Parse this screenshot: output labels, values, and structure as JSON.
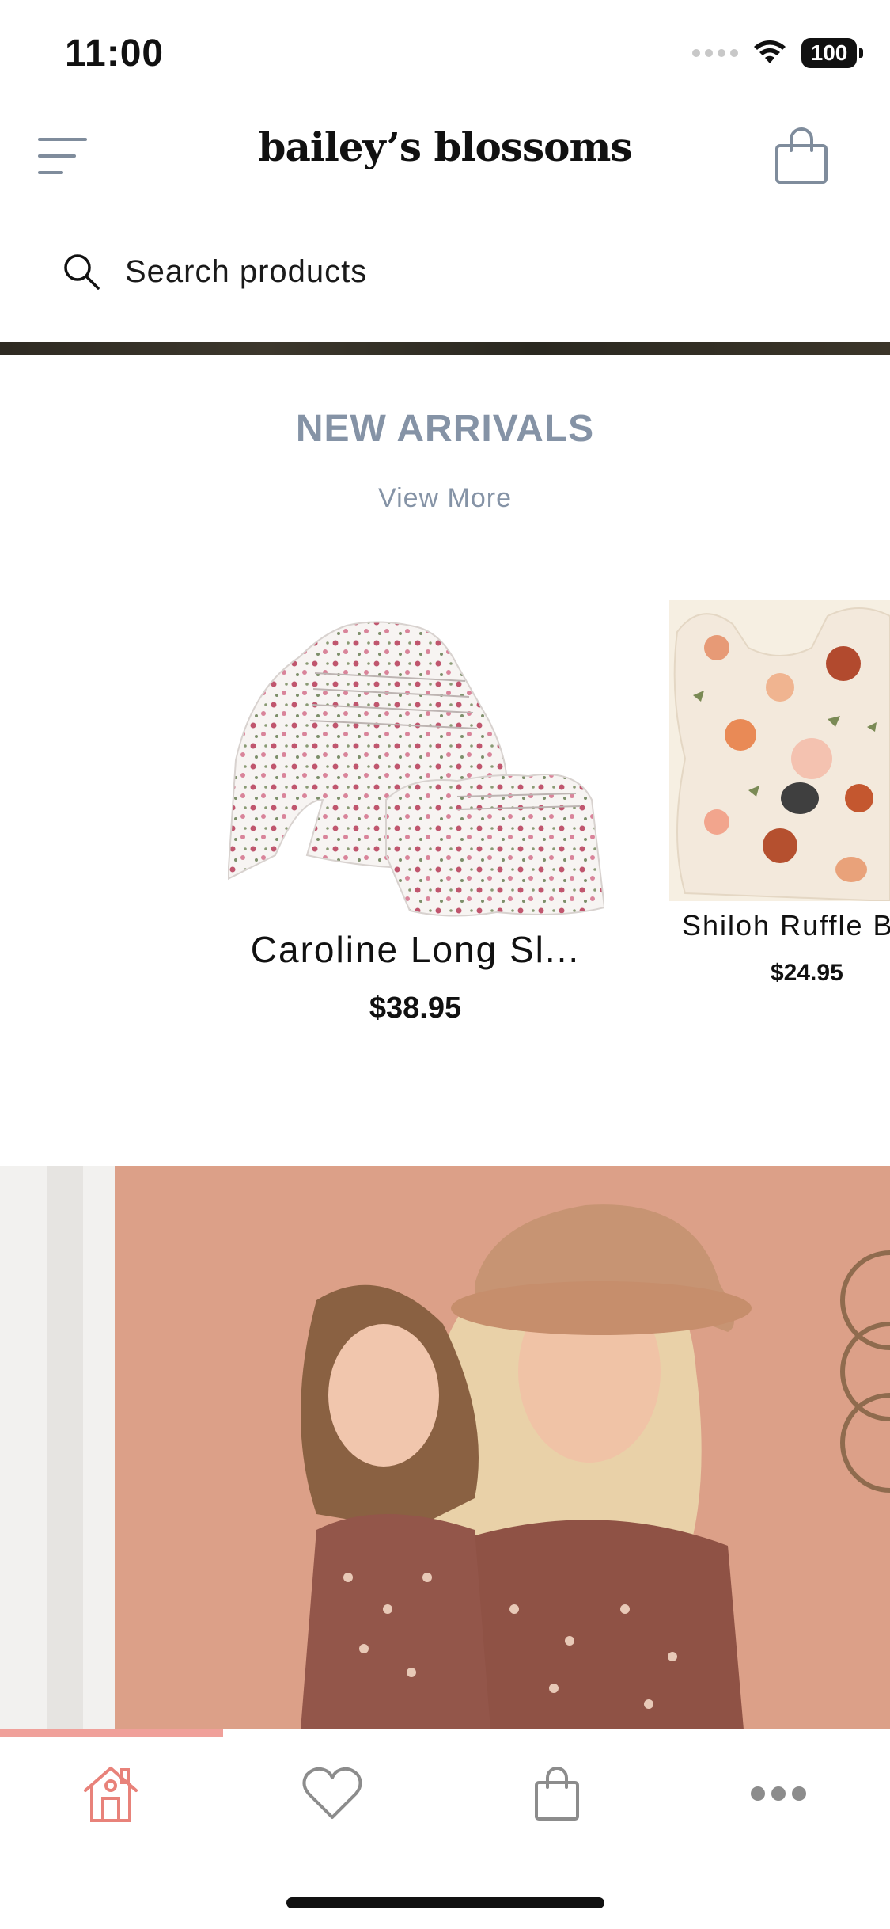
{
  "status_bar": {
    "time": "11:00",
    "battery": "100"
  },
  "header": {
    "brand": "bailey’s blossoms"
  },
  "search": {
    "placeholder": "Search products"
  },
  "section": {
    "title": "NEW ARRIVALS",
    "view_more": "View More"
  },
  "products": [
    {
      "name": "Caroline Long Sl...",
      "price": "$38.95"
    },
    {
      "name": "Shiloh Ruffle B",
      "price": "$24.95"
    }
  ],
  "tabs": [
    {
      "icon": "home-icon",
      "active": true
    },
    {
      "icon": "heart-icon",
      "active": false
    },
    {
      "icon": "shopping-bag-icon",
      "active": false
    },
    {
      "icon": "more-icon",
      "active": false
    }
  ],
  "colors": {
    "accent": "#E8827A",
    "muted": "#8593A6",
    "icon_gray": "#8c8c8c"
  }
}
